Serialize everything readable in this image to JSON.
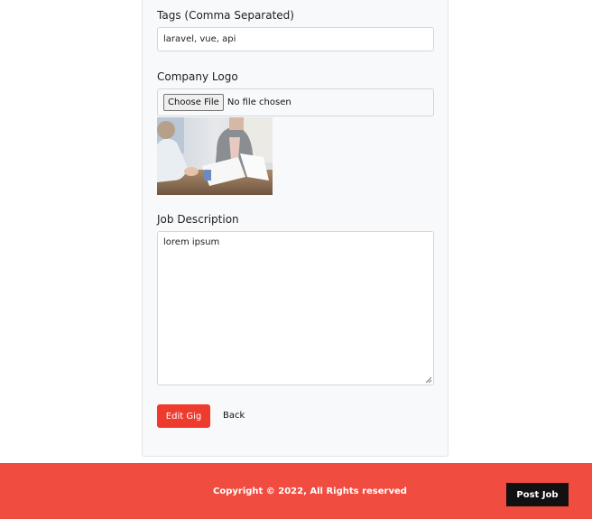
{
  "form": {
    "tags_label": "Tags (Comma Separated)",
    "tags_value": "laravel, vue, api",
    "logo_label": "Company Logo",
    "choose_file_label": "Choose File",
    "file_status": "No file chosen",
    "description_label": "Job Description",
    "description_value": "lorem ipsum",
    "submit_label": "Edit Gig",
    "back_label": "Back"
  },
  "footer": {
    "copyright": "Copyright © 2022, All Rights reserved",
    "post_job_label": "Post Job"
  },
  "colors": {
    "accent": "#ef3b2d",
    "footer_bg": "#f04c40",
    "card_bg": "#f8f9fb",
    "dark_button": "#111111"
  }
}
